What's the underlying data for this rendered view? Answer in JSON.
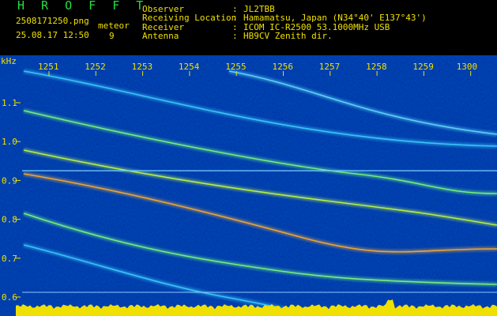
{
  "header": {
    "brand": "H R O F F T",
    "filename": "2508171250.png",
    "datetime": "25.08.17 12:50",
    "mode_label": "meteor",
    "mode_value": "9",
    "observer_label": "Observer",
    "observer_value": "JL2TBB",
    "location_label": "Receiving Location",
    "location_value": "Hamamatsu, Japan (N34°40' E137°43')",
    "receiver_label": "Receiver",
    "receiver_value": "ICOM IC-R2500 53.1000MHz USB",
    "antenna_label": "Antenna",
    "antenna_value": "HB9CV Zenith dir.",
    "sep": ":"
  },
  "colors": {
    "accent_yellow": "#f0e000",
    "brand_green": "#22e040",
    "background": "#00008a"
  },
  "chart_data": {
    "type": "heatmap",
    "title": "",
    "xlabel": "",
    "ylabel": "kHz",
    "x_ticks": [
      "1251",
      "1252",
      "1253",
      "1254",
      "1255",
      "1256",
      "1257",
      "1258",
      "1259",
      "1300"
    ],
    "y_ticks": [
      "1.1",
      "1.0",
      "0.9",
      "0.8",
      "0.7",
      "0.6"
    ],
    "ylim": [
      0.58,
      1.2
    ],
    "carrier_khz": 0.925,
    "grid": true
  }
}
